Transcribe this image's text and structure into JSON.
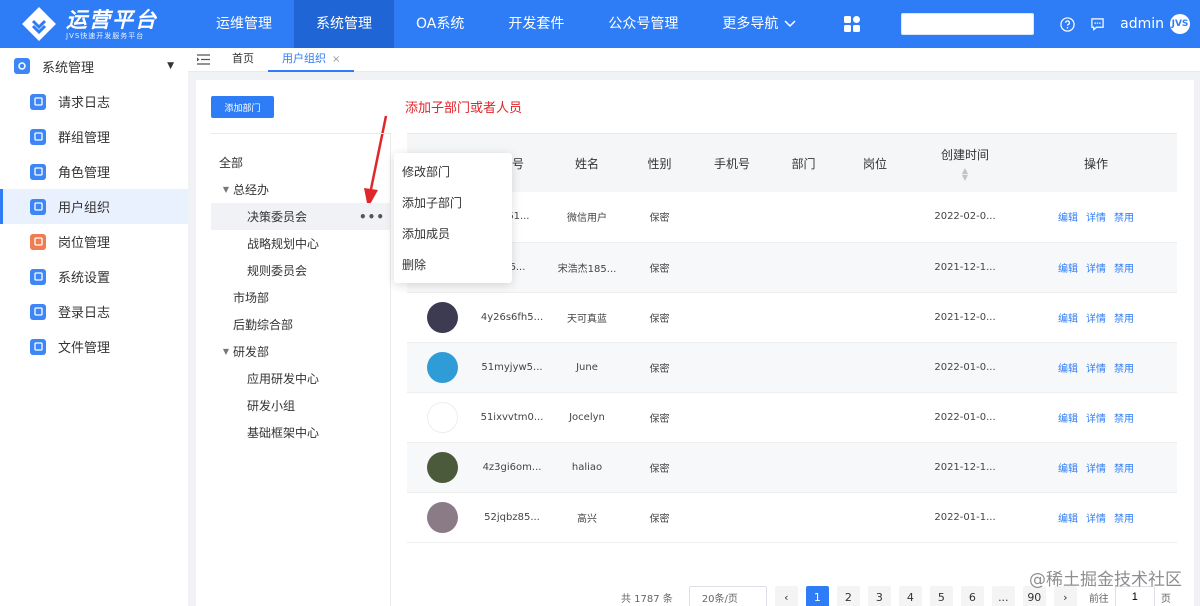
{
  "logo": {
    "title": "运营平台",
    "subtitle": "JVS快速开发服务平台"
  },
  "topnav": [
    "运维管理",
    "系统管理",
    "OA系统",
    "开发套件",
    "公众号管理",
    "更多导航"
  ],
  "user": {
    "name": "admin",
    "avatar_text": "JVS"
  },
  "sidebar": {
    "group": "系统管理",
    "items": [
      {
        "label": "请求日志",
        "icon": "request-log-icon",
        "color": "#3d86f7"
      },
      {
        "label": "群组管理",
        "icon": "group-icon",
        "color": "#3d86f7"
      },
      {
        "label": "角色管理",
        "icon": "role-icon",
        "color": "#3d86f7"
      },
      {
        "label": "用户组织",
        "icon": "user-org-icon",
        "color": "#3d86f7"
      },
      {
        "label": "岗位管理",
        "icon": "post-icon",
        "color": "#f07d52"
      },
      {
        "label": "系统设置",
        "icon": "settings-icon",
        "color": "#3d86f7"
      },
      {
        "label": "登录日志",
        "icon": "login-log-icon",
        "color": "#3d86f7"
      },
      {
        "label": "文件管理",
        "icon": "file-icon",
        "color": "#3d86f7"
      }
    ]
  },
  "tabs": [
    {
      "label": "首页"
    },
    {
      "label": "用户组织",
      "close": "×"
    }
  ],
  "toolbar": {
    "add_dept": "添加部门"
  },
  "hint": "添加子部门或者人员",
  "tree": [
    {
      "label": "全部"
    },
    {
      "label": "总经办",
      "caret": "▼"
    },
    {
      "label": "决策委员会"
    },
    {
      "label": "战略规划中心"
    },
    {
      "label": "规则委员会"
    },
    {
      "label": "市场部"
    },
    {
      "label": "后勤综合部"
    },
    {
      "label": "研发部",
      "caret": "▼"
    },
    {
      "label": "应用研发中心"
    },
    {
      "label": "研发小组"
    },
    {
      "label": "基础框架中心"
    }
  ],
  "context_menu": [
    "修改部门",
    "添加子部门",
    "添加成员",
    "删除"
  ],
  "table": {
    "columns": [
      "",
      "账号",
      "姓名",
      "性别",
      "手机号",
      "部门",
      "岗位",
      "创建时间",
      "操作"
    ],
    "rows": [
      {
        "account": "2u61...",
        "name": "微信用户",
        "gender": "保密",
        "created": "2022-02-0...",
        "avatar": "#dfe6ee"
      },
      {
        "account": "wj6...",
        "name": "宋浩杰185...",
        "gender": "保密",
        "created": "2021-12-1...",
        "avatar": "#9fb7a5"
      },
      {
        "account": "4y26s6fh5...",
        "name": "天可真蓝",
        "gender": "保密",
        "created": "2021-12-0...",
        "avatar": "#3d3b52"
      },
      {
        "account": "51myjyw5...",
        "name": "June",
        "gender": "保密",
        "created": "2022-01-0...",
        "avatar": "#2f9bd7"
      },
      {
        "account": "51ixvvtm0...",
        "name": "Jocelyn",
        "gender": "保密",
        "created": "2022-01-0...",
        "avatar": "#ffffff"
      },
      {
        "account": "4z3gi6om...",
        "name": "haliao",
        "gender": "保密",
        "created": "2021-12-1...",
        "avatar": "#4a5a3a"
      },
      {
        "account": "52jqbz85...",
        "name": "高兴",
        "gender": "保密",
        "created": "2022-01-1...",
        "avatar": "#8a7b86"
      }
    ],
    "actions": [
      "编辑",
      "详情",
      "禁用"
    ]
  },
  "pager": {
    "total": "共 1787 条",
    "size": "20条/页",
    "pages": [
      "1",
      "2",
      "3",
      "4",
      "5",
      "6",
      "...",
      "90"
    ],
    "prev": "‹",
    "next": "›",
    "jump_label": "前往",
    "jump_value": "1",
    "jump_suffix": "页"
  },
  "watermark": "@稀土掘金技术社区"
}
